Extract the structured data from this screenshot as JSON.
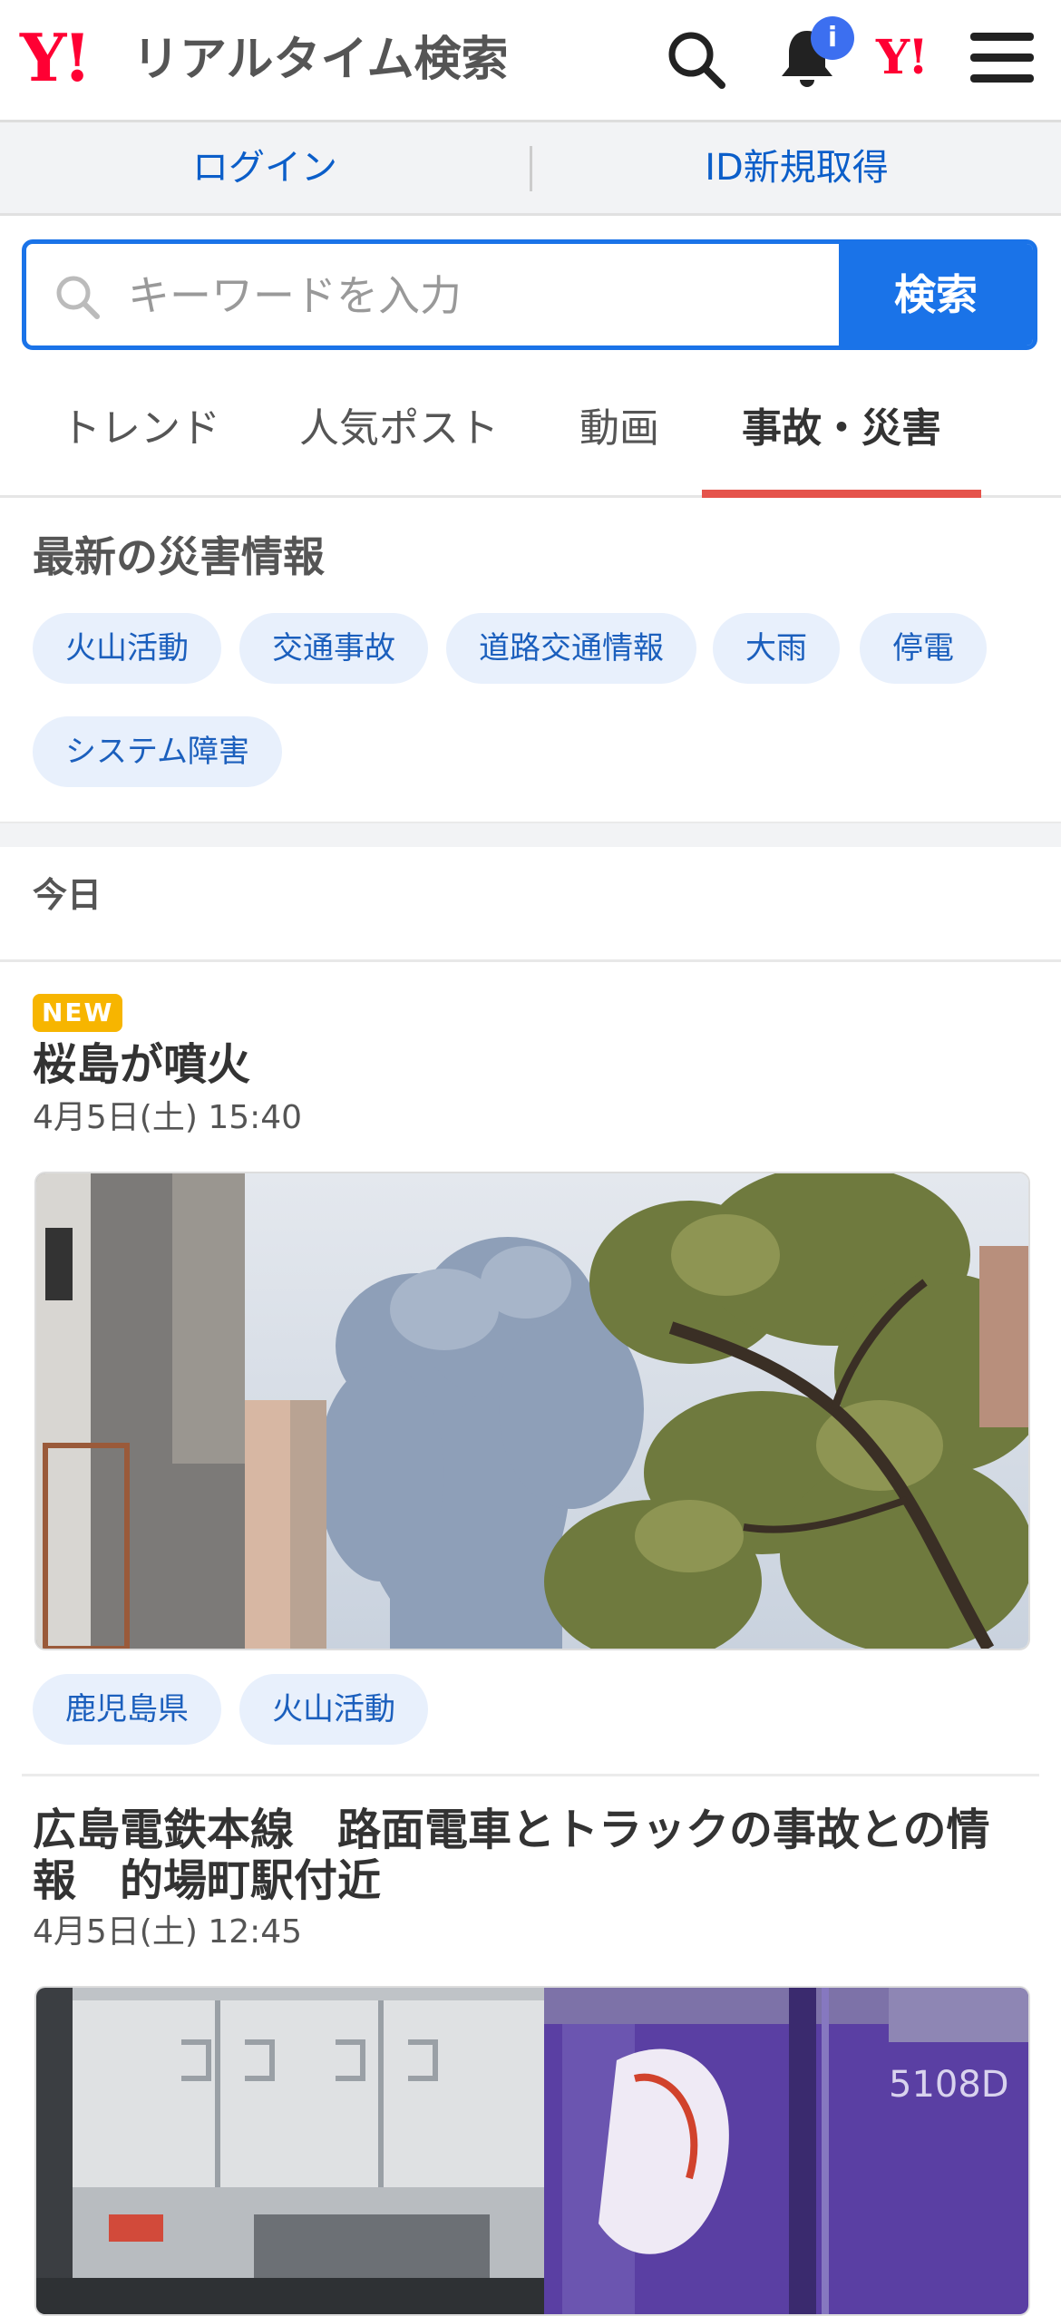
{
  "header": {
    "logo_y": "Y!",
    "logo_text": "リアルタイム検索",
    "notification_badge": "i",
    "yahoo_mark": "Y!"
  },
  "account": {
    "login": "ログイン",
    "signup": "ID新規取得"
  },
  "search": {
    "placeholder": "キーワードを入力",
    "button": "検索"
  },
  "tabs": [
    {
      "label": "トレンド",
      "active": false
    },
    {
      "label": "人気ポスト",
      "active": false
    },
    {
      "label": "動画",
      "active": false
    },
    {
      "label": "事故・災害",
      "active": true
    }
  ],
  "disaster_info": {
    "title": "最新の災害情報",
    "chips": [
      "火山活動",
      "交通事故",
      "道路交通情報",
      "大雨",
      "停電",
      "システム障害"
    ]
  },
  "date_section": "今日",
  "articles": [
    {
      "badge": "NEW",
      "title": "桜島が噴火",
      "date": "4月5日(土) 15:40",
      "tags": [
        "鹿児島県",
        "火山活動"
      ]
    },
    {
      "title": "広島電鉄本線　路面電車とトラックの事故との情報　的場町駅付近",
      "date": "4月5日(土) 12:45"
    }
  ],
  "colors": {
    "accent_blue": "#1a73e8",
    "brand_red": "#ff0033",
    "tab_indicator": "#e5534b",
    "chip_bg": "#e8f0fc",
    "new_badge": "#f7b500"
  },
  "icons": [
    "search-icon",
    "bell-icon",
    "menu-icon",
    "magnifier-icon"
  ]
}
